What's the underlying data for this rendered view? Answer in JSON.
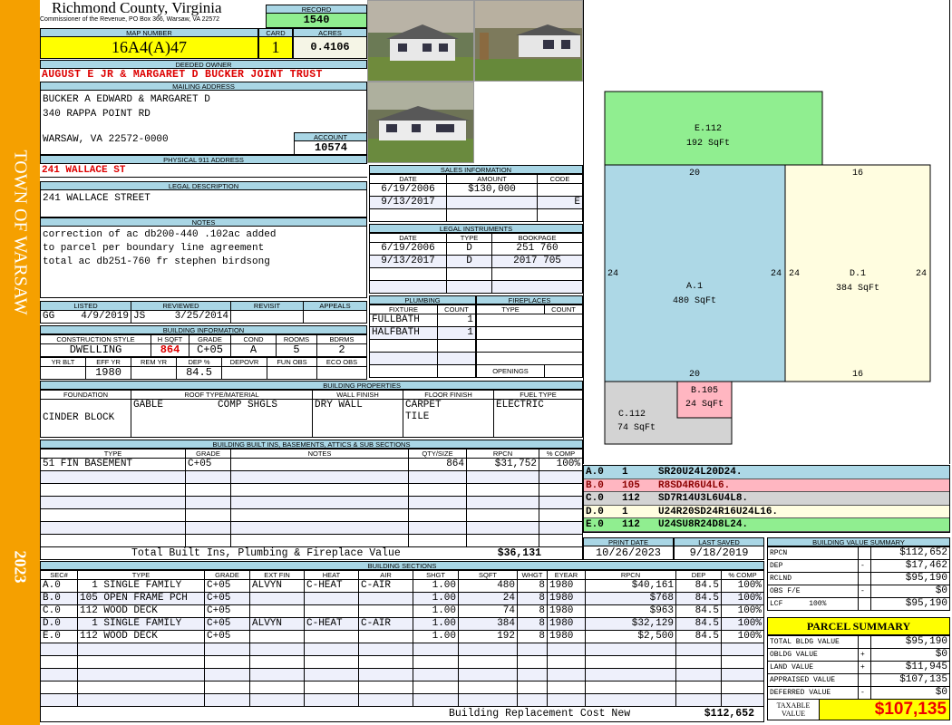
{
  "sidebar": {
    "town": "TOWN OF WARSAW",
    "year": "2023"
  },
  "header": {
    "county": "Richmond County, Virginia",
    "subtitle": "Commissioner of the Revenue, PO Box 366, Warsaw, VA 22572",
    "record_label": "RECORD",
    "record": "1540"
  },
  "parcel": {
    "map_label": "MAP NUMBER",
    "map_number": "16A4(A)47",
    "card_label": "CARD",
    "card": "1",
    "acres_label": "ACRES",
    "acres": "0.4106"
  },
  "owner": {
    "label": "DEEDED OWNER",
    "name": "AUGUST E JR & MARGARET D BUCKER JOINT TRUST"
  },
  "mailing": {
    "label": "MAILING ADDRESS",
    "lines": [
      "BUCKER A EDWARD & MARGARET D",
      "340 RAPPA POINT RD",
      "WARSAW, VA 22572-0000"
    ],
    "account_label": "ACCOUNT",
    "account": "10574"
  },
  "physical": {
    "label": "PHYSICAL 911 ADDRESS",
    "address": "241 WALLACE ST"
  },
  "legal": {
    "label": "LEGAL DESCRIPTION",
    "text": "241 WALLACE STREET"
  },
  "notes": {
    "label": "NOTES",
    "lines": [
      "correction of ac db200-440 .102ac added",
      "to parcel per boundary line agreement",
      "total ac db251-760 fr stephen birdsong"
    ]
  },
  "review": {
    "headers": [
      "LISTED",
      "REVIEWED",
      "REVISIT",
      "APPEALS"
    ],
    "listed_by": "GG",
    "listed": "4/9/2019",
    "reviewed_by": "JS",
    "reviewed": "3/25/2014",
    "revisit": "",
    "appeals": ""
  },
  "building_info": {
    "label": "BUILDING INFORMATION",
    "headers1": [
      "CONSTRUCTION STYLE",
      "H SQFT",
      "GRADE",
      "COND",
      "ROOMS",
      "BDRMS"
    ],
    "values1": [
      "DWELLING",
      "864",
      "C+05",
      "A",
      "5",
      "2"
    ],
    "headers2": [
      "YR BLT",
      "EFF YR",
      "REM YR",
      "DEP %",
      "DEPOVR",
      "FUN OBS",
      "ECO OBS"
    ],
    "values2": [
      "",
      "1980",
      "",
      "84.5",
      "",
      "",
      ""
    ]
  },
  "sales": {
    "label": "SALES INFORMATION",
    "headers": [
      "DATE",
      "AMOUNT",
      "CODE"
    ],
    "rows": [
      [
        "6/19/2006",
        "$130,000",
        ""
      ],
      [
        "9/13/2017",
        "",
        "E"
      ]
    ]
  },
  "instruments": {
    "label": "LEGAL INSTRUMENTS",
    "headers": [
      "DATE",
      "TYPE",
      "BOOKPAGE"
    ],
    "rows": [
      [
        "6/19/2006",
        "D",
        "251 760"
      ],
      [
        "9/13/2017",
        "D",
        "2017 705"
      ]
    ]
  },
  "plumbing": {
    "label": "PLUMBING",
    "headers": [
      "FIXTURE",
      "COUNT"
    ],
    "rows": [
      [
        "FULLBATH",
        "1"
      ],
      [
        "HALFBATH",
        "1"
      ]
    ]
  },
  "fireplaces": {
    "label": "FIREPLACES",
    "headers": [
      "TYPE",
      "COUNT"
    ],
    "openings_label": "OPENINGS"
  },
  "properties": {
    "label": "BUILDING PROPERTIES",
    "headers": [
      "FOUNDATION",
      "ROOF TYPE/MATERIAL",
      "WALL FINISH",
      "FLOOR FINISH",
      "FUEL TYPE"
    ],
    "foundation": "CINDER BLOCK",
    "roof_type": "GABLE",
    "roof_material": "COMP SHGLS",
    "wall": "DRY WALL",
    "floor": [
      "CARPET",
      "TILE"
    ],
    "fuel": "ELECTRIC"
  },
  "builtins": {
    "label": "BUILDING BUILT INS, BASEMENTS, ATTICS & SUB SECTIONS",
    "headers": [
      "TYPE",
      "GRADE",
      "NOTES",
      "QTY/SIZE",
      "RPCN",
      "% COMP"
    ],
    "rows": [
      [
        "51 FIN BASEMENT",
        "C+05",
        "",
        "864",
        "$31,752",
        "100%"
      ]
    ],
    "total_label": "Total Built Ins, Plumbing & Fireplace Value",
    "total": "$36,131"
  },
  "sections": {
    "label": "BUILDING SECTIONS",
    "headers": [
      "SEC#",
      "TYPE",
      "GRADE",
      "EXT FIN",
      "HEAT",
      "AIR",
      "SHGT",
      "SQFT",
      "WHGT",
      "EYEAR",
      "RPCN",
      "DEP",
      "% COMP"
    ],
    "rows": [
      [
        "A.0",
        "  1 SINGLE FAMILY",
        "C+05",
        "ALVYN",
        "C-HEAT",
        "C-AIR",
        "1.00",
        "480",
        "8",
        "1980",
        "$40,161",
        "84.5",
        "100%"
      ],
      [
        "B.0",
        "105 OPEN FRAME PCH",
        "C+05",
        "",
        "",
        "",
        "1.00",
        "24",
        "8",
        "1980",
        "$768",
        "84.5",
        "100%"
      ],
      [
        "C.0",
        "112 WOOD DECK",
        "C+05",
        "",
        "",
        "",
        "1.00",
        "74",
        "8",
        "1980",
        "$963",
        "84.5",
        "100%"
      ],
      [
        "D.0",
        "  1 SINGLE FAMILY",
        "C+05",
        "ALVYN",
        "C-HEAT",
        "C-AIR",
        "1.00",
        "384",
        "8",
        "1980",
        "$32,129",
        "84.5",
        "100%"
      ],
      [
        "E.0",
        "112 WOOD DECK",
        "C+05",
        "",
        "",
        "",
        "1.00",
        "192",
        "8",
        "1980",
        "$2,500",
        "84.5",
        "100%"
      ]
    ],
    "total_label": "Building Replacement Cost New",
    "total": "$112,652"
  },
  "dates": {
    "print_label": "PRINT DATE",
    "print": "10/26/2023",
    "saved_label": "LAST SAVED",
    "saved": "9/18/2019"
  },
  "sketch": {
    "areas": [
      {
        "id": "E.112",
        "sqft": "192 SqFt",
        "color": "#90ee90"
      },
      {
        "id": "A.1",
        "sqft": "480 SqFt",
        "color": "#add8e6"
      },
      {
        "id": "D.1",
        "sqft": "384 SqFt",
        "color": "#fffde0"
      },
      {
        "id": "B.105",
        "sqft": "24 SqFt",
        "color": "#ffb6c1"
      },
      {
        "id": "C.112",
        "sqft": "74 SqFt",
        "color": "#d3d3d3"
      }
    ],
    "dims": {
      "a_top": "20",
      "d_top": "16",
      "a_left": "24",
      "a_right": "24",
      "d_left": "24",
      "d_right": "24",
      "a_bottom": "20",
      "d_bottom": "16"
    },
    "legend": [
      {
        "sec": "A.0",
        "code": "1",
        "path": "SR20U24L20D24.",
        "color": "#add8e6",
        "text": "#000"
      },
      {
        "sec": "B.0",
        "code": "105",
        "path": "R8SD4R6U4L6.",
        "color": "#ffb6c1",
        "text": "#8b0000"
      },
      {
        "sec": "C.0",
        "code": "112",
        "path": "SD7R14U3L6U4L8.",
        "color": "#d3d3d3",
        "text": "#000"
      },
      {
        "sec": "D.0",
        "code": "1",
        "path": "U24R20SD24R16U24L16.",
        "color": "#fffde0",
        "text": "#000"
      },
      {
        "sec": "E.0",
        "code": "112",
        "path": "U24SU8R24D8L24.",
        "color": "#90ee90",
        "text": "#000"
      }
    ]
  },
  "value_summary": {
    "label": "BUILDING VALUE SUMMARY",
    "rows": [
      [
        "RPCN",
        "",
        "$112,652"
      ],
      [
        "DEP",
        "-",
        "$17,462"
      ],
      [
        "RCLND",
        "",
        "$95,190"
      ],
      [
        "OBS F/E",
        "-",
        "$0"
      ],
      [
        "LCF      100%",
        "",
        "$95,190"
      ]
    ]
  },
  "parcel_summary": {
    "label": "PARCEL SUMMARY",
    "rows": [
      [
        "TOTAL BLDG VALUE",
        "",
        "$95,190"
      ],
      [
        "OBLDG VALUE",
        "+",
        "$0"
      ],
      [
        "LAND VALUE",
        "+",
        "$11,945"
      ],
      [
        "APPRAISED VALUE",
        "",
        "$107,135"
      ],
      [
        "DEFERRED VALUE",
        "-",
        "$0"
      ]
    ],
    "taxable_label": "TAXABLE VALUE",
    "taxable": "$107,135"
  }
}
